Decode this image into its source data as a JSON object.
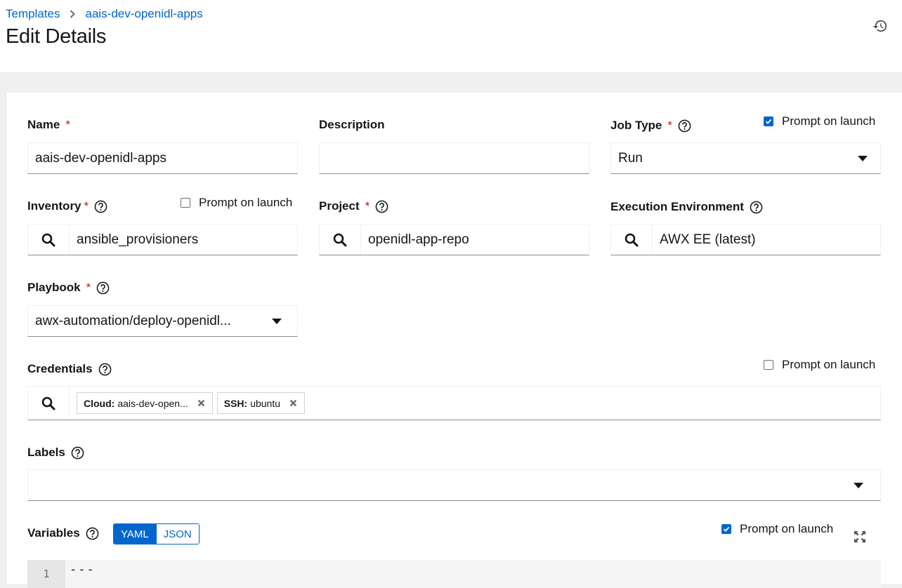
{
  "breadcrumb": {
    "parent": "Templates",
    "current": "aais-dev-openidl-apps"
  },
  "page": {
    "title": "Edit Details"
  },
  "form": {
    "name": {
      "label": "Name",
      "value": "aais-dev-openidl-apps"
    },
    "description": {
      "label": "Description",
      "value": ""
    },
    "job_type": {
      "label": "Job Type",
      "value": "Run",
      "prompt_label": "Prompt on launch",
      "prompt_checked": true
    },
    "inventory": {
      "label": "Inventory",
      "value": "ansible_provisioners",
      "prompt_label": "Prompt on launch",
      "prompt_checked": false
    },
    "project": {
      "label": "Project",
      "value": "openidl-app-repo"
    },
    "execution_environment": {
      "label": "Execution Environment",
      "value": "AWX EE (latest)"
    },
    "playbook": {
      "label": "Playbook",
      "value": "awx-automation/deploy-openidl..."
    },
    "credentials": {
      "label": "Credentials",
      "prompt_label": "Prompt on launch",
      "prompt_checked": false,
      "chips": [
        {
          "type": "Cloud:",
          "name": "aais-dev-open..."
        },
        {
          "type": "SSH:",
          "name": "ubuntu"
        }
      ]
    },
    "labels": {
      "label": "Labels",
      "value": ""
    },
    "variables": {
      "label": "Variables",
      "toggle": {
        "yaml": "YAML",
        "json": "JSON",
        "active": "YAML"
      },
      "prompt_label": "Prompt on launch",
      "prompt_checked": true,
      "editor": {
        "line_number": "1",
        "line_text": "---"
      }
    }
  },
  "colors": {
    "link": "#0066cc",
    "required": "#c9190b",
    "accent": "#0066cc"
  },
  "icons": {
    "history": "history-icon",
    "search": "search-icon",
    "help": "help-icon",
    "remove": "close-icon",
    "expand": "expand-icon"
  }
}
